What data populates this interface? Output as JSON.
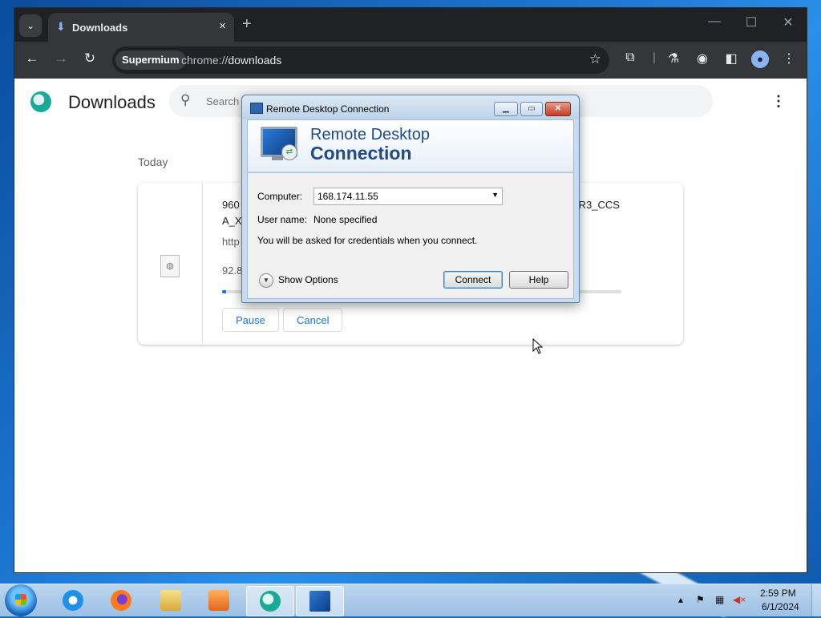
{
  "browser": {
    "tab_title": "Downloads",
    "tab_close": "×",
    "new_tab": "+",
    "tab_menu": "⌄",
    "win_min": "—",
    "win_max": "☐",
    "win_close": "✕",
    "nav_back": "←",
    "nav_forward": "→",
    "nav_reload": "↻",
    "chip": "Supermium",
    "url_prefix": "chrome://",
    "url_host": "downloads",
    "star": "☆"
  },
  "downloads_page": {
    "title": "Downloads",
    "search_placeholder": "Search d",
    "kebab": "⋮",
    "section_date": "Today",
    "item": {
      "name_line1": "960",
      "name_line2": "A_X",
      "name_right": "IR3_CCS",
      "url": "http",
      "size": "92.8",
      "progress": 0.01,
      "pause_label": "Pause",
      "cancel_label": "Cancel"
    }
  },
  "rdp_dialog": {
    "title": "Remote Desktop Connection",
    "heading_line1": "Remote Desktop",
    "heading_line2": "Connection",
    "computer_label": "Computer:",
    "computer_value": "168.174.11.55",
    "username_label": "User name:",
    "username_value": "None specified",
    "credentials_note": "You will be asked for credentials when you connect.",
    "show_options": "Show Options",
    "connect_label": "Connect",
    "help_label": "Help"
  },
  "taskbar": {
    "time": "2:59 PM",
    "date": "6/1/2024"
  }
}
